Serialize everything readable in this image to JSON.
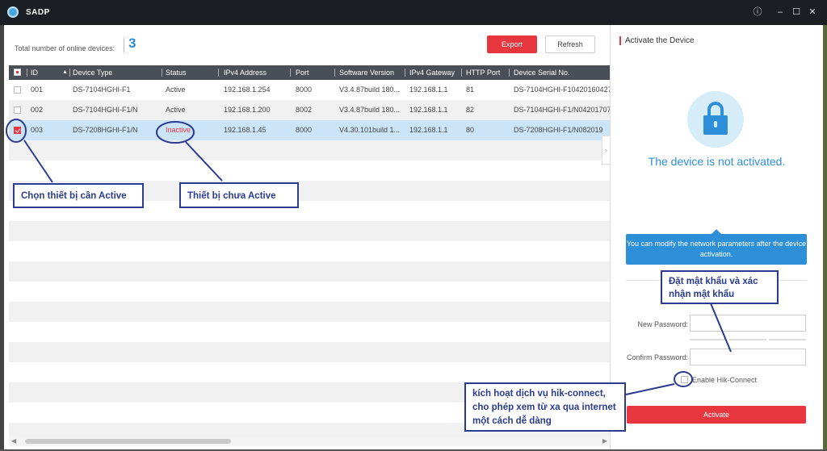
{
  "window": {
    "title": "SADP"
  },
  "header": {
    "total_label": "Total number of online devices:",
    "total_count": "3",
    "export_label": "Export",
    "refresh_label": "Refresh"
  },
  "table": {
    "columns": [
      "ID",
      "Device Type",
      "Status",
      "IPv4 Address",
      "Port",
      "Software Version",
      "IPv4 Gateway",
      "HTTP Port",
      "Device Serial No."
    ],
    "rows": [
      {
        "id": "001",
        "type": "DS-7104HGHI-F1",
        "status": "Active",
        "ip": "192.168.1.254",
        "port": "8000",
        "version": "V3.4.87build 180...",
        "gateway": "192.168.1.1",
        "http": "81",
        "serial": "DS-7104HGHI-F10420160427"
      },
      {
        "id": "002",
        "type": "DS-7104HGHI-F1/N",
        "status": "Active",
        "ip": "192.168.1.200",
        "port": "8002",
        "version": "V3.4.87build 180...",
        "gateway": "192.168.1.1",
        "http": "82",
        "serial": "DS-7104HGHI-F1/N04201707"
      },
      {
        "id": "003",
        "type": "DS-7208HGHI-F1/N",
        "status": "Inactive",
        "ip": "192.168.1.45",
        "port": "8000",
        "version": "V4.30.101build 1...",
        "gateway": "192.168.1.1",
        "http": "80",
        "serial": "DS-7208HGHI-F1/N082019"
      }
    ]
  },
  "panel": {
    "title": "Activate the Device",
    "not_activated": "The device is not activated.",
    "info": "You can modify the network parameters after the device activation.",
    "new_password_label": "New Password:",
    "confirm_password_label": "Confirm Password:",
    "hik_connect_label": "Enable Hik-Connect",
    "activate_label": "Activate"
  },
  "callouts": {
    "select_device": "Chọn thiết bị cần Active",
    "not_active": "Thiết bị chưa Active",
    "password": "Đặt mật khẩu và xác nhận mật khẩu",
    "hik_connect": "kích hoạt dịch vụ hik-connect, cho phép xem từ xa qua internet một cách dễ dàng"
  },
  "colors": {
    "accent_red": "#e8363f",
    "accent_blue": "#2d8fd8",
    "callout_navy": "#2b3b8f",
    "selected_row": "#cce4f7"
  }
}
